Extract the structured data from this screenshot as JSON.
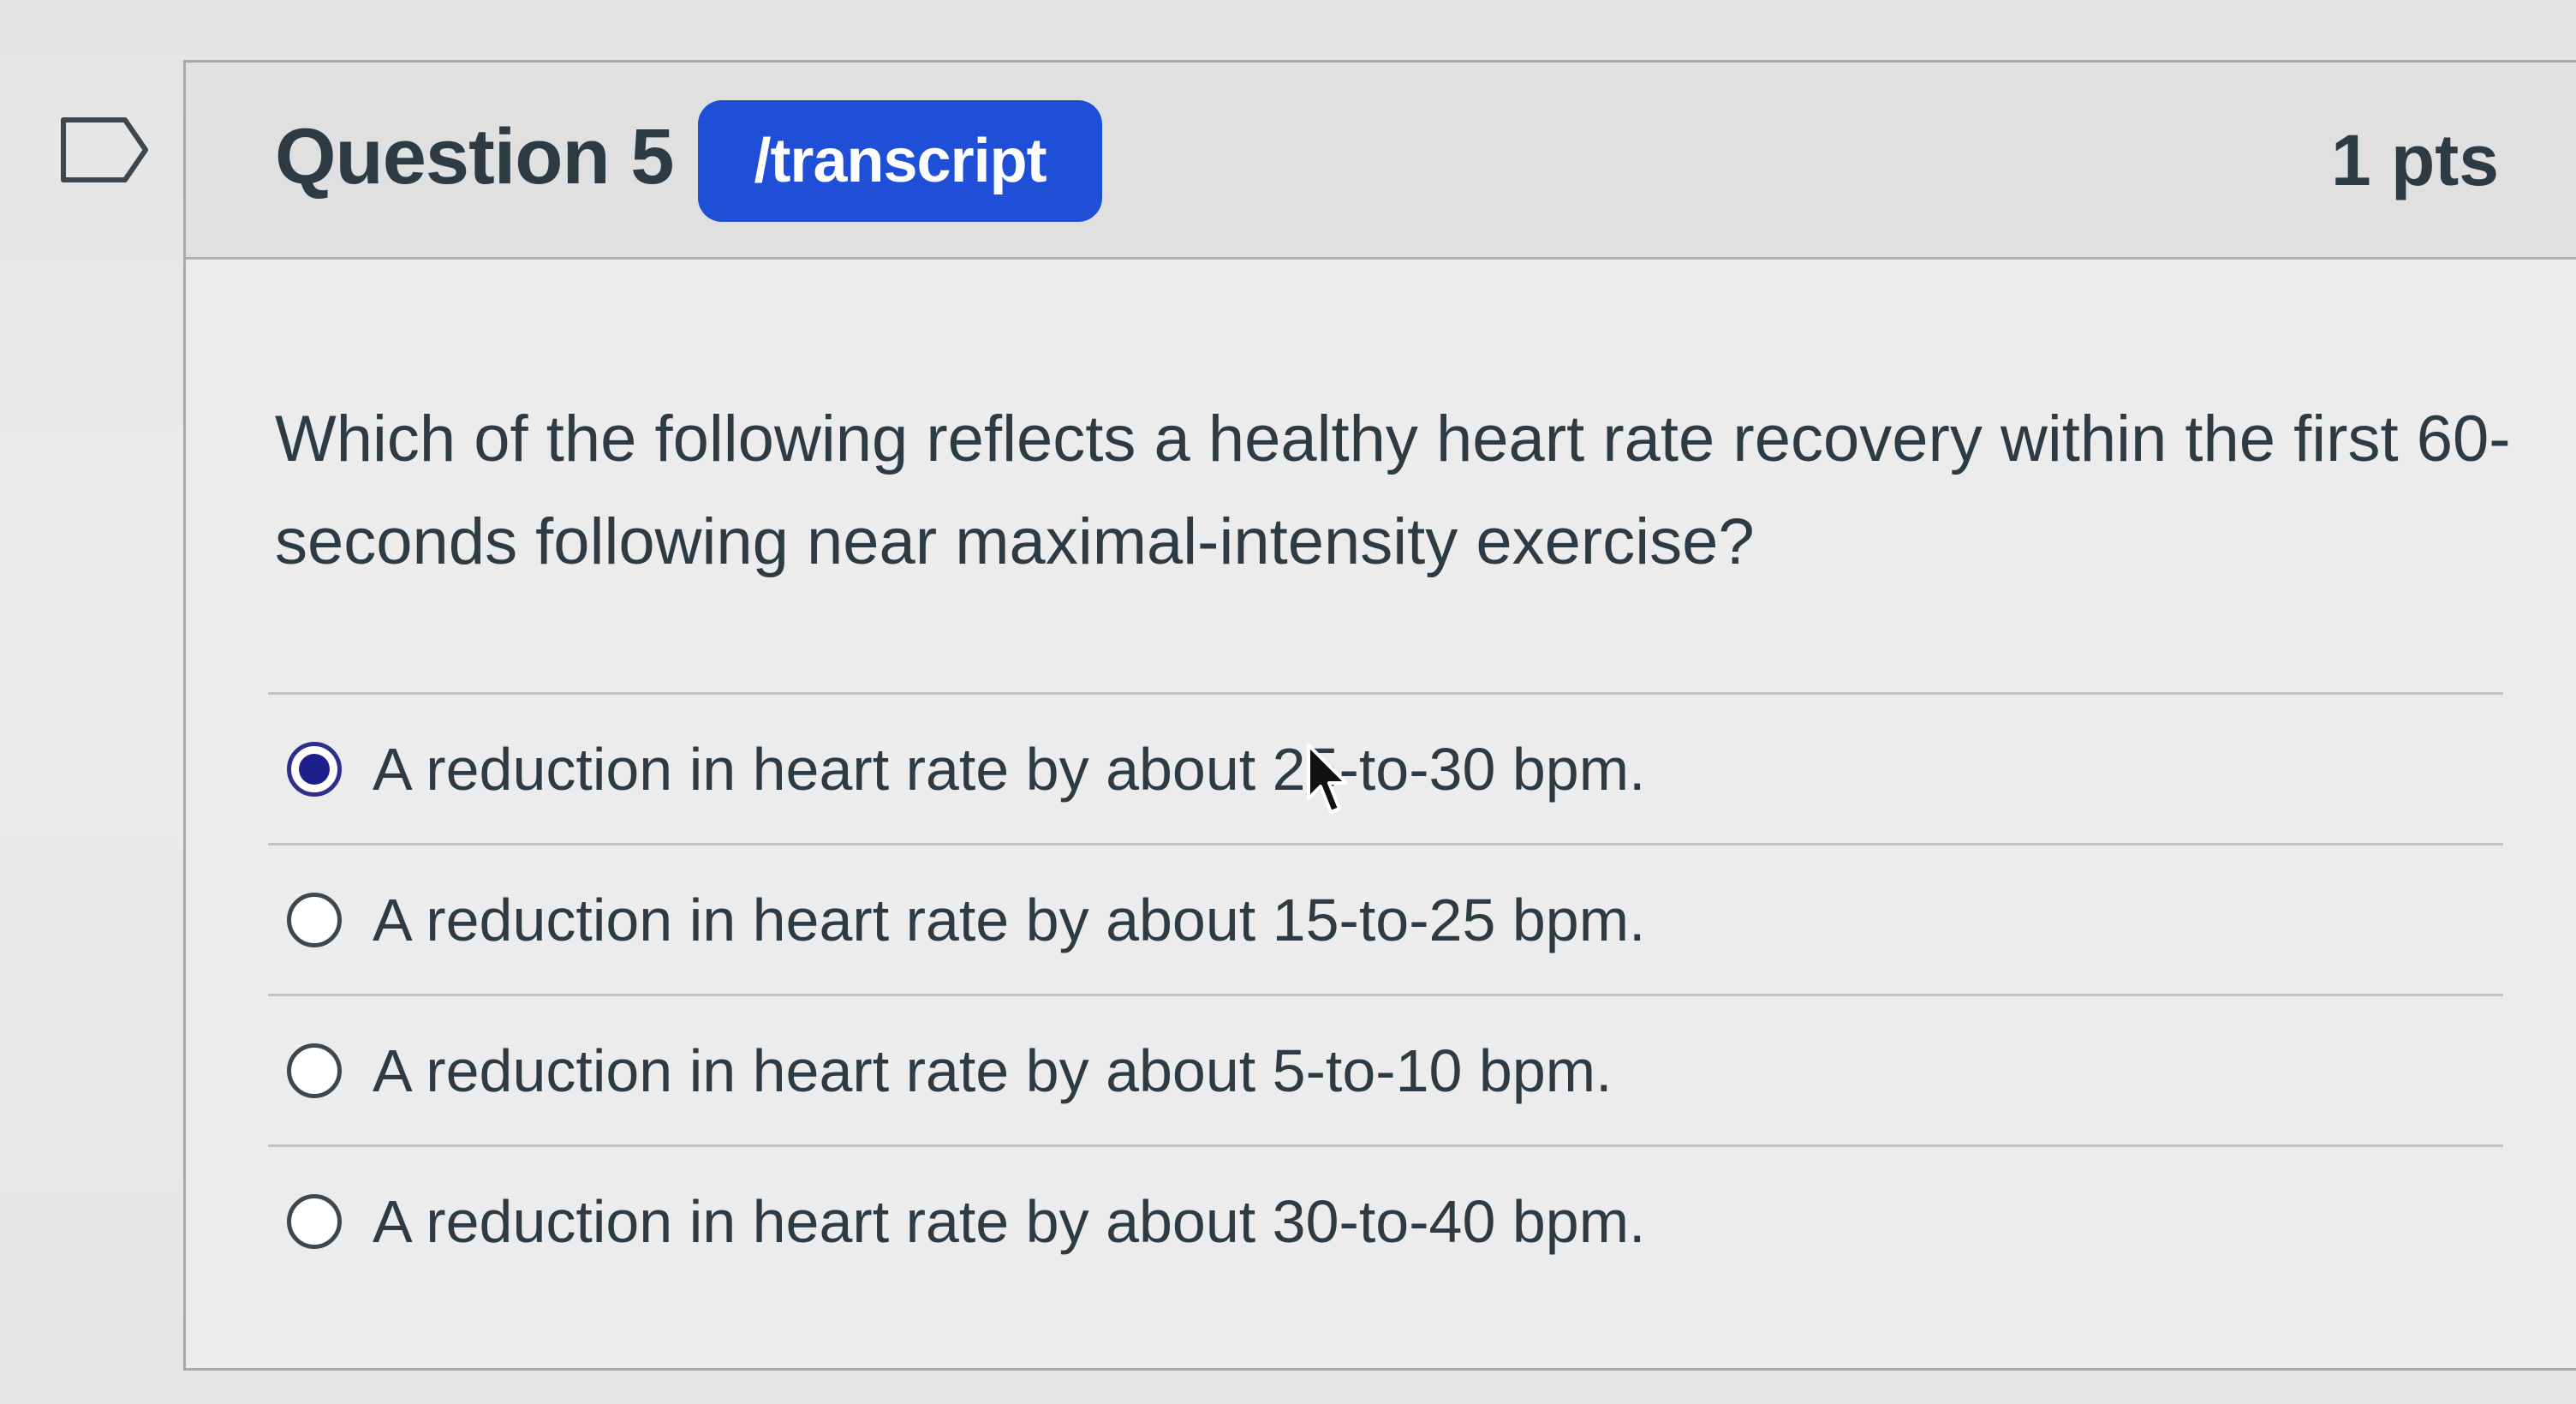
{
  "question": {
    "title": "Question 5",
    "badge": "/transcript",
    "points": "1 pts",
    "text": "Which of the following reflects a healthy heart rate recovery within the first 60-seconds following near maximal-intensity exercise?"
  },
  "answers": [
    {
      "label": "A reduction in heart rate by about 25-to-30 bpm.",
      "selected": true
    },
    {
      "label": "A reduction in heart rate by about 15-to-25 bpm.",
      "selected": false
    },
    {
      "label": "A reduction in heart rate by about 5-to-10 bpm.",
      "selected": false
    },
    {
      "label": "A reduction in heart rate by about 30-to-40 bpm.",
      "selected": false
    }
  ],
  "colors": {
    "badge": "#1f4fd6",
    "text": "#2d3b45",
    "radio_selected": "#1d1f8a"
  },
  "icons": {
    "flag": "flag-outline-icon",
    "cursor": "mouse-pointer-icon"
  }
}
